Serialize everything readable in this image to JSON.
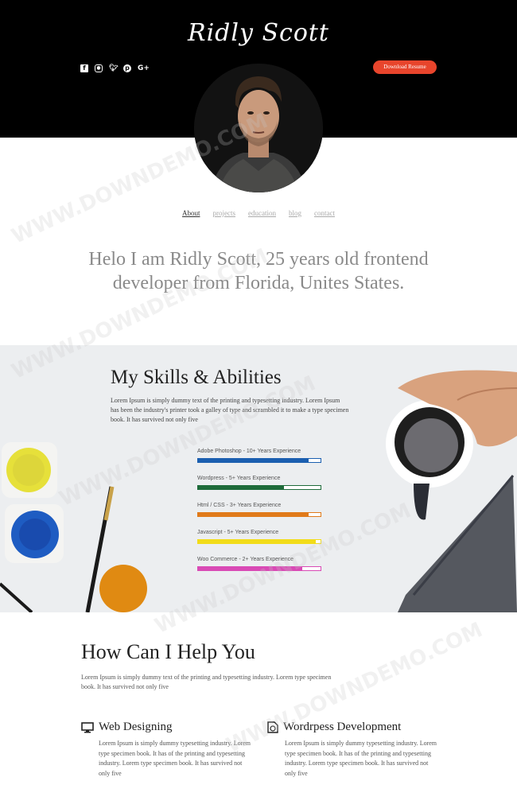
{
  "header": {
    "logo_text": "Ridly Scott",
    "download_button": "Download Resume",
    "social_icons": [
      "facebook-icon",
      "instagram-icon",
      "twitter-icon",
      "pinterest-icon",
      "google-plus-icon"
    ]
  },
  "nav": {
    "items": [
      {
        "label": "About",
        "active": true
      },
      {
        "label": "projects",
        "active": false
      },
      {
        "label": "education",
        "active": false
      },
      {
        "label": "blog",
        "active": false
      },
      {
        "label": "contact",
        "active": false
      }
    ]
  },
  "intro": {
    "text": "Helo I am Ridly Scott, 25 years old frontend developer from Florida, Unites States."
  },
  "skills": {
    "title": "My Skills & Abilities",
    "description": "Lorem Ipsum is simply dummy text of the printing and typesetting industry. Lorem Ipsum has been the industry's printer took a galley of type and scrambled it to make a type specimen book. It has survived not only five",
    "items": [
      {
        "label": "Adobe Photoshop - 10+ Years Experience",
        "level": 0.9,
        "color": "#1b5fb0"
      },
      {
        "label": "Wordpress - 5+ Years Experience",
        "level": 0.7,
        "color": "#1e6b3a"
      },
      {
        "label": "Html / CSS - 3+ Years Experience",
        "level": 0.9,
        "color": "#e07a1a"
      },
      {
        "label": "Javascript - 5+ Years Experience",
        "level": 0.96,
        "color": "#f2dc1a"
      },
      {
        "label": "Woo Commerce - 2+ Years Experience",
        "level": 0.85,
        "color": "#d94ab5"
      }
    ]
  },
  "help": {
    "title": "How Can I Help You",
    "description": "Lorem Ipsum is simply dummy text of the printing and typesetting industry. Lorem type specimen book. It has survived not only five",
    "services": [
      {
        "icon": "monitor-icon",
        "title": "Web Designing",
        "text": "Lorem Ipsum is simply dummy typesetting industry. Lorem type specimen book. It has of the printing and typesetting industry. Lorem type specimen book. It has survived not only five"
      },
      {
        "icon": "wordpress-file-icon",
        "title": "Wordrpess Development",
        "text": "Lorem Ipsum is simply dummy typesetting industry. Lorem type specimen book. It has of the printing and typesetting industry. Lorem type specimen book. It has survived not only five"
      }
    ]
  },
  "watermark_text": "WWW.DOWNDEMO.COM",
  "colors": {
    "accent": "#e8452c",
    "header_bg": "#000000",
    "skills_bg": "#eceef0"
  }
}
